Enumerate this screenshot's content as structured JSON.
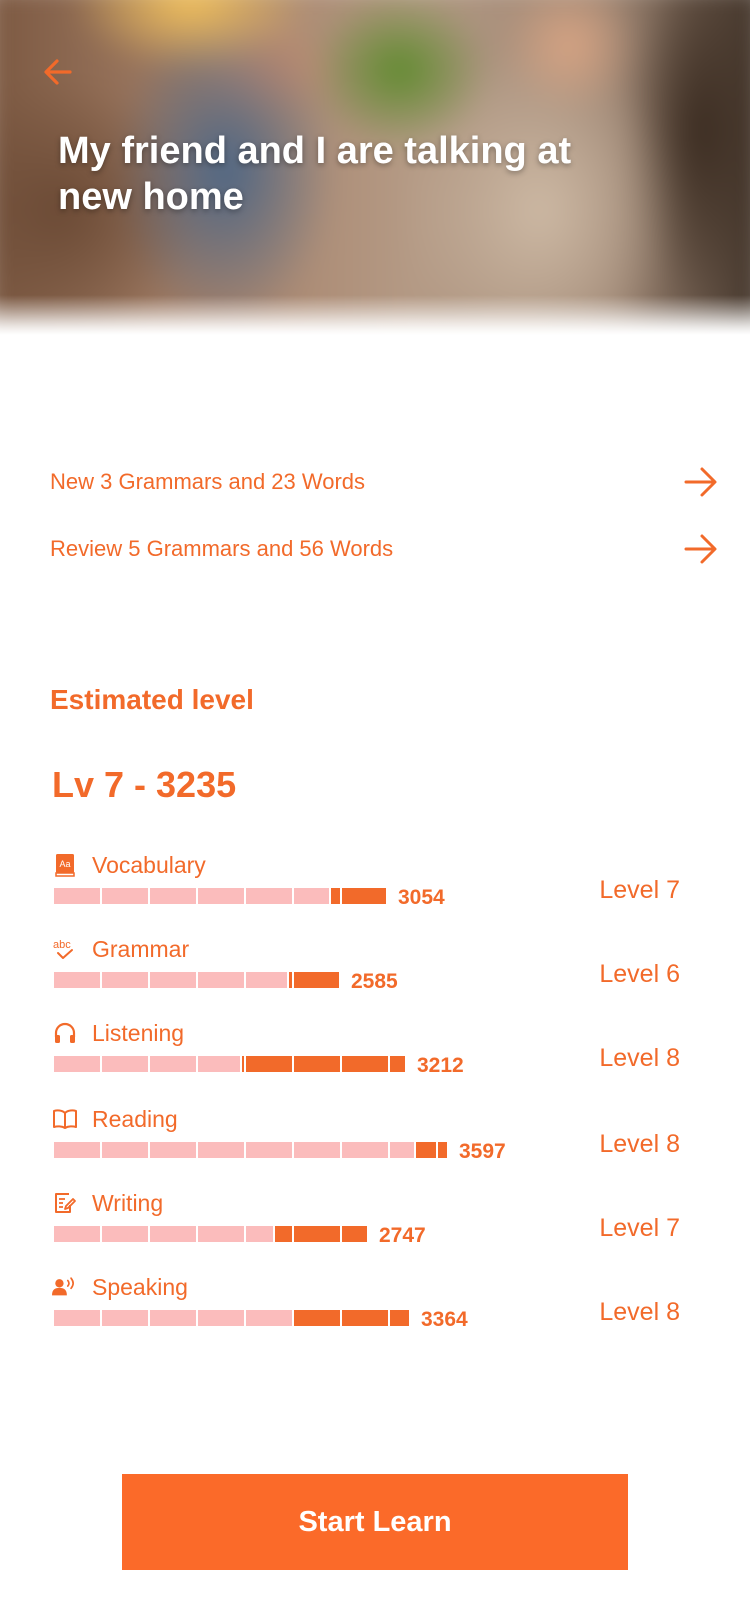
{
  "lesson": {
    "title": "My friend and I are talking at new home"
  },
  "links": [
    {
      "label": "New 3 Grammars and 23 Words",
      "icon": "arrow-right-icon"
    },
    {
      "label": "Review 5 Grammars and 56 Words",
      "icon": "arrow-right-icon"
    }
  ],
  "estimate": {
    "section_title": "Estimated level",
    "overall": "Lv 7 - 3235"
  },
  "skills": [
    {
      "name": "Vocabulary",
      "icon": "book-aa-icon",
      "score": "3054",
      "level": "Level 7",
      "progress": 0.71,
      "fill_start": 0.59
    },
    {
      "name": "Grammar",
      "icon": "abc-check-icon",
      "score": "2585",
      "level": "Level 6",
      "progress": 0.61,
      "fill_start": 0.5
    },
    {
      "name": "Listening",
      "icon": "headphones-icon",
      "score": "3212",
      "level": "Level 8",
      "progress": 0.75,
      "fill_start": 0.4
    },
    {
      "name": "Reading",
      "icon": "open-book-icon",
      "score": "3597",
      "level": "Level 8",
      "progress": 0.84,
      "fill_start": 0.77
    },
    {
      "name": "Writing",
      "icon": "edit-note-icon",
      "score": "2747",
      "level": "Level 7",
      "progress": 0.67,
      "fill_start": 0.47
    },
    {
      "name": "Speaking",
      "icon": "speaking-person-icon",
      "score": "3364",
      "level": "Level 8",
      "progress": 0.76,
      "fill_start": 0.51
    }
  ],
  "cta": {
    "label": "Start Learn"
  },
  "colors": {
    "accent": "#f26a2a",
    "button": "#fb6a29",
    "bar_track": "#fbbcbc",
    "bar_fill": "#f26a2a"
  }
}
